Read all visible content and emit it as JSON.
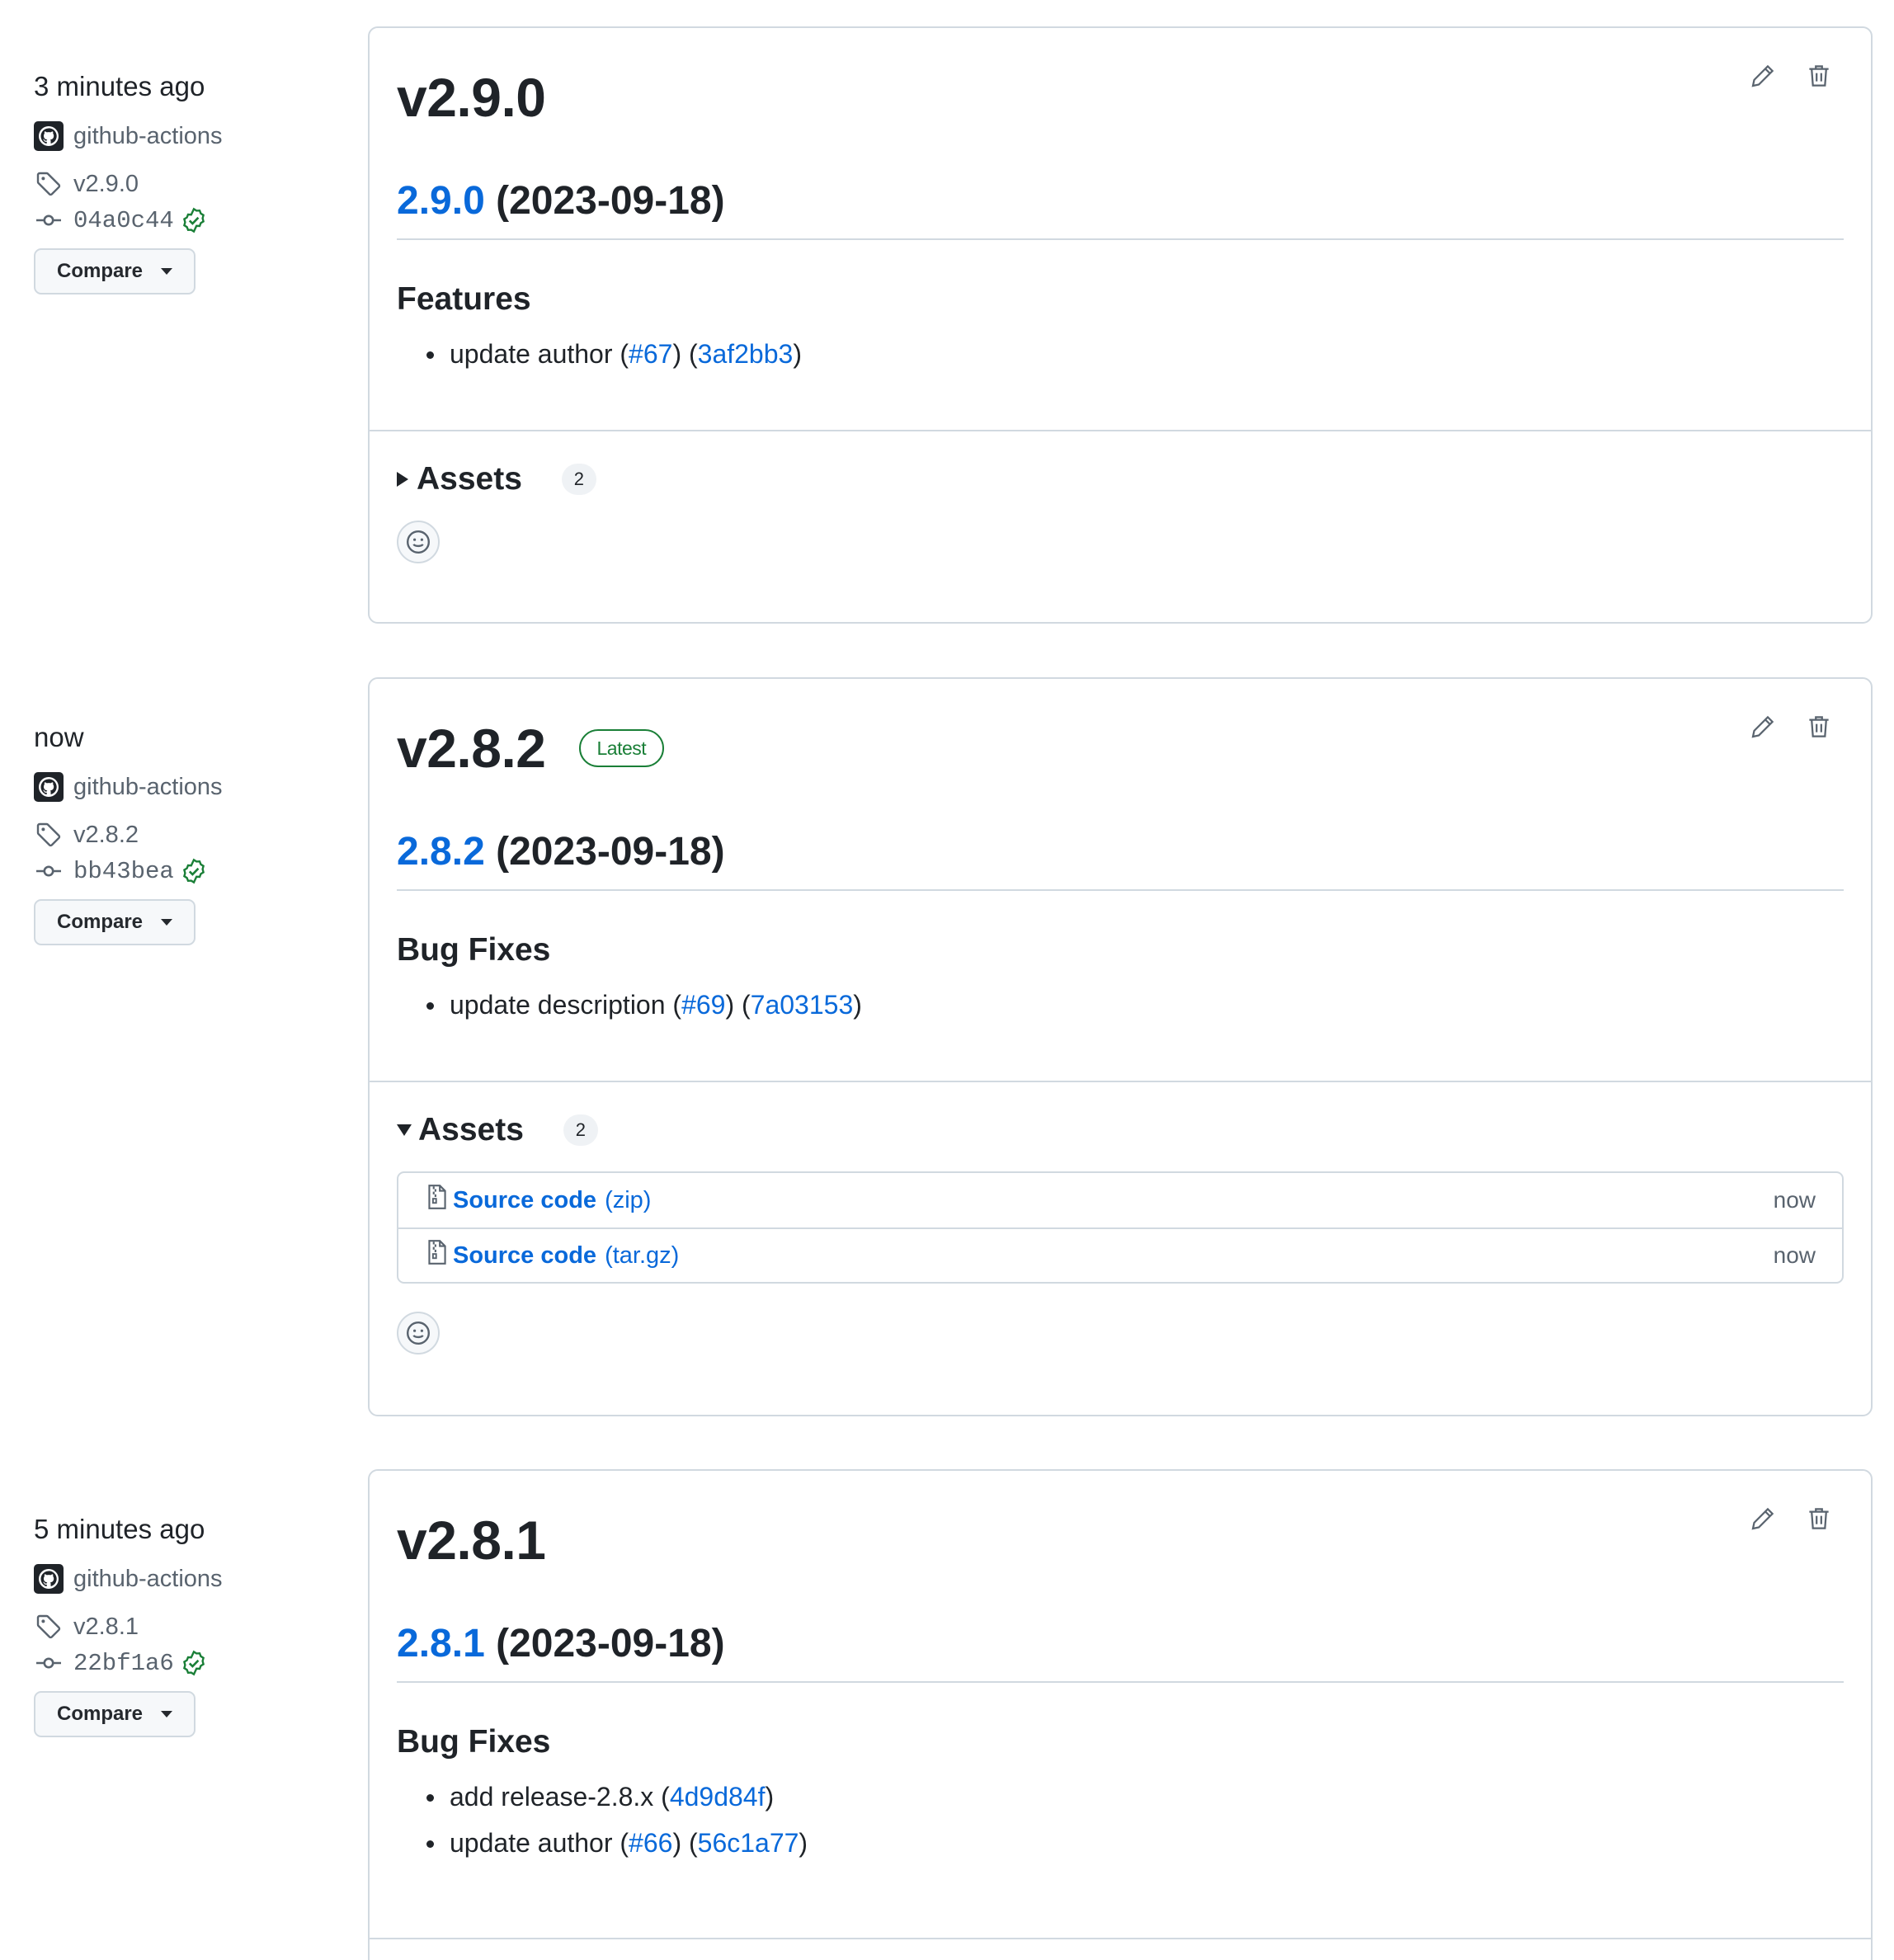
{
  "releases": [
    {
      "time": "3 minutes ago",
      "author": "github-actions",
      "tag": "v2.9.0",
      "commit": "04a0c44",
      "compare_label": "Compare",
      "title": "v2.9.0",
      "version_link": "2.9.0",
      "date": "(2023-09-18)",
      "section": "Features",
      "items": [
        {
          "text": "update author (",
          "pr": "#67",
          "mid": ") (",
          "hash": "3af2bb3",
          "end": ")"
        }
      ],
      "assets_label": "Assets",
      "assets_count": "2",
      "assets_open": false
    },
    {
      "time": "now",
      "author": "github-actions",
      "tag": "v2.8.2",
      "commit": "bb43bea",
      "compare_label": "Compare",
      "title": "v2.8.2",
      "badge": "Latest",
      "version_link": "2.8.2",
      "date": "(2023-09-18)",
      "section": "Bug Fixes",
      "items": [
        {
          "text": "update description (",
          "pr": "#69",
          "mid": ") (",
          "hash": "7a03153",
          "end": ")"
        }
      ],
      "assets_label": "Assets",
      "assets_count": "2",
      "assets_open": true,
      "assets": [
        {
          "name": "Source code",
          "ext": "(zip)",
          "when": "now"
        },
        {
          "name": "Source code",
          "ext": "(tar.gz)",
          "when": "now"
        }
      ]
    },
    {
      "time": "5 minutes ago",
      "author": "github-actions",
      "tag": "v2.8.1",
      "commit": "22bf1a6",
      "compare_label": "Compare",
      "title": "v2.8.1",
      "version_link": "2.8.1",
      "date": "(2023-09-18)",
      "section": "Bug Fixes",
      "items": [
        {
          "text": "add release-2.8.x (",
          "hash": "4d9d84f",
          "end": ")"
        },
        {
          "text": "update author (",
          "pr": "#66",
          "mid": ") (",
          "hash": "56c1a77",
          "end": ")"
        }
      ]
    }
  ],
  "icons": {
    "edit": "pencil-icon",
    "delete": "trash-icon",
    "tag": "tag-icon",
    "commit": "git-commit-icon",
    "verified": "verified-check-icon",
    "avatar": "github-logo-icon",
    "emoji": "smiley-icon",
    "file": "file-zip-icon"
  },
  "colors": {
    "link": "#0969da",
    "success": "#1a7f37",
    "border": "#d1d9e0",
    "muted": "#59636e"
  }
}
